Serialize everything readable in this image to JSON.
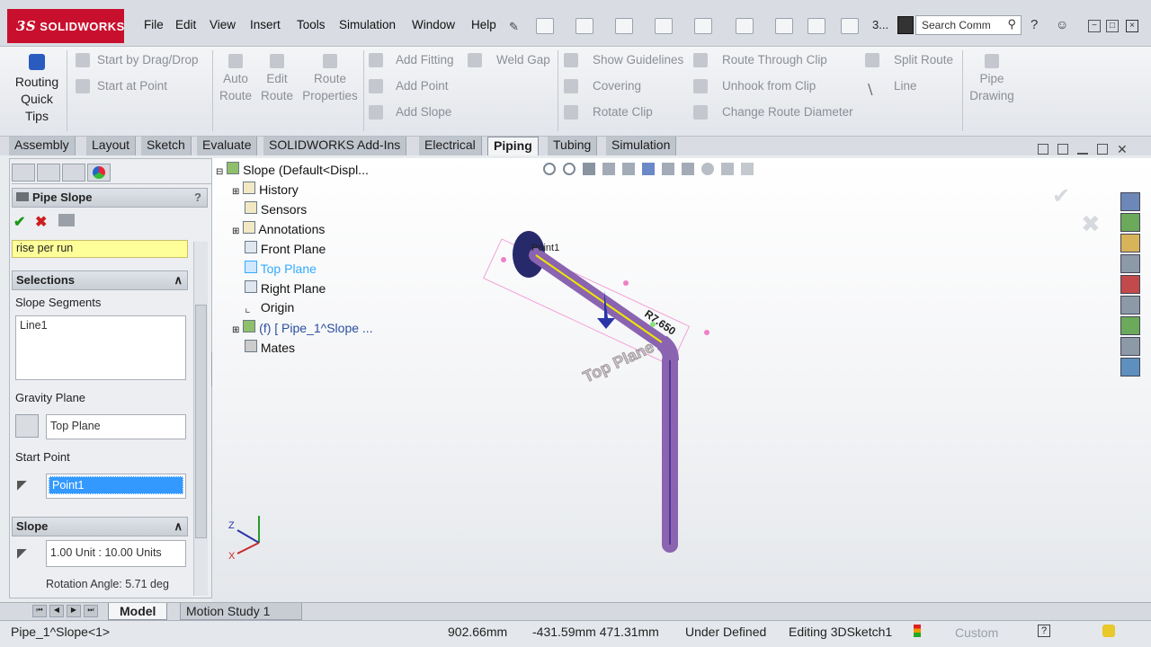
{
  "app": {
    "brand": "SOLIDWORKS",
    "brand_prefix": "3S"
  },
  "menu": [
    "File",
    "Edit",
    "View",
    "Insert",
    "Tools",
    "Simulation",
    "Window",
    "Help"
  ],
  "toolbar_extra": "3...",
  "search": {
    "placeholder": "Search Comm"
  },
  "command_manager": {
    "quick_tips": [
      "Routing",
      "Quick",
      "Tips"
    ],
    "start_drag": "Start by Drag/Drop",
    "start_point": "Start at Point",
    "auto_route": [
      "Auto",
      "Route"
    ],
    "edit_route": [
      "Edit",
      "Route"
    ],
    "route_properties": [
      "Route",
      "Properties"
    ],
    "add_fitting": "Add Fitting",
    "add_point": "Add Point",
    "add_slope": "Add Slope",
    "weld_gap": "Weld Gap",
    "show_guidelines": "Show Guidelines",
    "covering": "Covering",
    "rotate_clip": "Rotate Clip",
    "route_through_clip": "Route Through Clip",
    "unhook_from_clip": "Unhook from Clip",
    "change_route_diameter": "Change Route Diameter",
    "split_route": "Split Route",
    "line": "Line",
    "pipe_drawing": [
      "Pipe",
      "Drawing"
    ]
  },
  "tabs": [
    "Assembly",
    "Layout",
    "Sketch",
    "Evaluate",
    "SOLIDWORKS Add-Ins",
    "Electrical",
    "Piping",
    "Tubing",
    "Simulation"
  ],
  "active_tab": "Piping",
  "property_manager": {
    "title": "Pipe Slope",
    "help": "?",
    "message": "rise per run",
    "selections_header": "Selections",
    "slope_segments_label": "Slope Segments",
    "slope_segments": [
      "Line1"
    ],
    "gravity_plane_label": "Gravity Plane",
    "gravity_plane_value": "Top Plane",
    "start_point_label": "Start Point",
    "start_point_value": "Point1",
    "slope_header": "Slope",
    "slope_value": "1.00 Unit : 10.00 Units",
    "rotation_angle": "Rotation Angle: 5.71 deg"
  },
  "tree": {
    "root": "Slope  (Default<Displ...",
    "items": [
      "History",
      "Sensors",
      "Annotations",
      "Front Plane",
      "Top Plane",
      "Right Plane",
      "Origin",
      "(f) [ Pipe_1^Slope ...",
      "Mates"
    ]
  },
  "viewport": {
    "labels": {
      "point": "Point1",
      "radius": "R7.650",
      "plane": "Top Plane"
    },
    "axes": {
      "z": "Z",
      "x": "X"
    }
  },
  "bottom_tabs": [
    "Model",
    "Motion Study 1"
  ],
  "status": {
    "doc": "Pipe_1^Slope<1>",
    "distance": "902.66mm",
    "coords": "-431.59mm 471.31mm",
    "state": "Under Defined",
    "editing": "Editing 3DSketch1",
    "units": "Custom",
    "help": "?"
  },
  "colors": {
    "pipe": "#8a64b0",
    "accent": "#0a64d8",
    "message_bg": "#ffff99",
    "selected_tree": "#33aaff"
  }
}
